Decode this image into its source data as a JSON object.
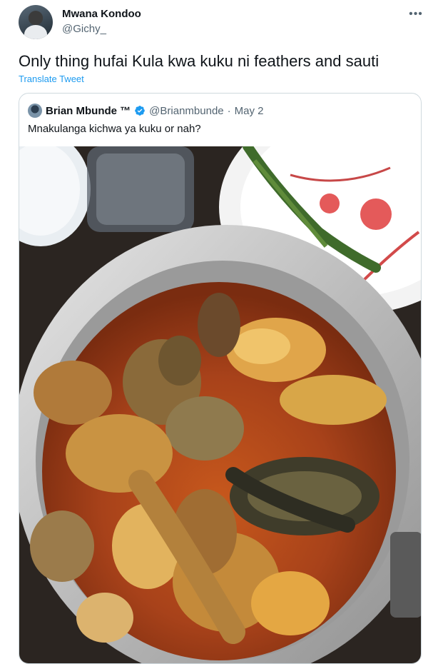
{
  "tweet": {
    "author_name": "Mwana Kondoo",
    "author_handle": "@Gichy_",
    "more_icon": "more-horizontal-icon",
    "text": "Only thing hufai Kula kwa kuku ni feathers and sauti",
    "translate_label": "Translate Tweet"
  },
  "quoted": {
    "author_name": "Brian Mbunde ™",
    "verified_icon": "verified-badge-icon",
    "author_handle": "@Brianmbunde",
    "separator": "·",
    "date": "May 2",
    "text": "Mnakulanga kichwa ya kuku or nah?",
    "image": "photo of chicken stew in a metal pot"
  },
  "colors": {
    "accent": "#1d9bf0",
    "secondary_text": "#536471",
    "border": "#cfd9de"
  }
}
